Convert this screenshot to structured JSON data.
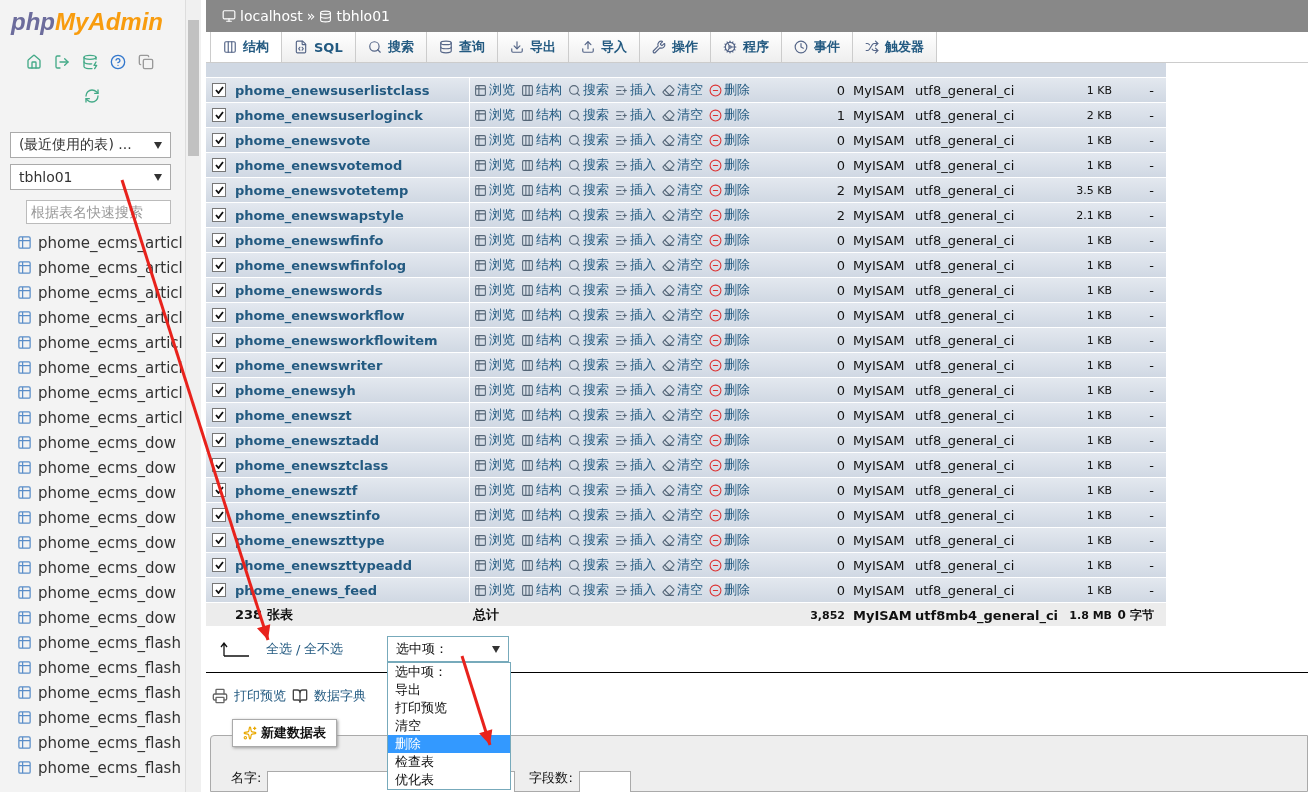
{
  "sidebar": {
    "logo_php": "php",
    "logo_name": "MyAdmin",
    "recent_select": "(最近使用的表) ...",
    "db_select": "tbhlo01",
    "filter_placeholder": "根据表名快速搜索",
    "tables": [
      "phome_ecms_articl",
      "phome_ecms_articl",
      "phome_ecms_articl",
      "phome_ecms_articl",
      "phome_ecms_articl",
      "phome_ecms_articl",
      "phome_ecms_articl",
      "phome_ecms_articl",
      "phome_ecms_dow",
      "phome_ecms_dow",
      "phome_ecms_dow",
      "phome_ecms_dow",
      "phome_ecms_dow",
      "phome_ecms_dow",
      "phome_ecms_dow",
      "phome_ecms_dow",
      "phome_ecms_flash",
      "phome_ecms_flash",
      "phome_ecms_flash",
      "phome_ecms_flash",
      "phome_ecms_flash",
      "phome_ecms_flash"
    ]
  },
  "breadcrumb": {
    "server": "localhost",
    "separator": "»",
    "database": "tbhlo01"
  },
  "tabs": [
    {
      "label": "结构",
      "selected": true
    },
    {
      "label": "SQL",
      "selected": false
    },
    {
      "label": "搜索",
      "selected": false
    },
    {
      "label": "查询",
      "selected": false
    },
    {
      "label": "导出",
      "selected": false
    },
    {
      "label": "导入",
      "selected": false
    },
    {
      "label": "操作",
      "selected": false
    },
    {
      "label": "程序",
      "selected": false
    },
    {
      "label": "事件",
      "selected": false
    },
    {
      "label": "触发器",
      "selected": false
    }
  ],
  "table": {
    "rows": [
      {
        "name": "phome_enewsuserlistclass",
        "checked": true,
        "actions": [
          "浏览",
          "结构",
          "搜索",
          "插入",
          "清空",
          "删除"
        ],
        "rows": "0",
        "engine": "MyISAM",
        "collation": "utf8_general_ci",
        "size": "1 KB",
        "overhead": "-"
      },
      {
        "name": "phome_enewsuserloginck",
        "checked": true,
        "actions": [
          "浏览",
          "结构",
          "搜索",
          "插入",
          "清空",
          "删除"
        ],
        "rows": "1",
        "engine": "MyISAM",
        "collation": "utf8_general_ci",
        "size": "2 KB",
        "overhead": "-"
      },
      {
        "name": "phome_enewsvote",
        "checked": true,
        "actions": [
          "浏览",
          "结构",
          "搜索",
          "插入",
          "清空",
          "删除"
        ],
        "rows": "0",
        "engine": "MyISAM",
        "collation": "utf8_general_ci",
        "size": "1 KB",
        "overhead": "-"
      },
      {
        "name": "phome_enewsvotemod",
        "checked": true,
        "actions": [
          "浏览",
          "结构",
          "搜索",
          "插入",
          "清空",
          "删除"
        ],
        "rows": "0",
        "engine": "MyISAM",
        "collation": "utf8_general_ci",
        "size": "1 KB",
        "overhead": "-"
      },
      {
        "name": "phome_enewsvotetemp",
        "checked": true,
        "actions": [
          "浏览",
          "结构",
          "搜索",
          "插入",
          "清空",
          "删除"
        ],
        "rows": "2",
        "engine": "MyISAM",
        "collation": "utf8_general_ci",
        "size": "3.5 KB",
        "overhead": "-"
      },
      {
        "name": "phome_enewswapstyle",
        "checked": true,
        "actions": [
          "浏览",
          "结构",
          "搜索",
          "插入",
          "清空",
          "删除"
        ],
        "rows": "2",
        "engine": "MyISAM",
        "collation": "utf8_general_ci",
        "size": "2.1 KB",
        "overhead": "-"
      },
      {
        "name": "phome_enewswfinfo",
        "checked": true,
        "actions": [
          "浏览",
          "结构",
          "搜索",
          "插入",
          "清空",
          "删除"
        ],
        "rows": "0",
        "engine": "MyISAM",
        "collation": "utf8_general_ci",
        "size": "1 KB",
        "overhead": "-"
      },
      {
        "name": "phome_enewswfinfolog",
        "checked": true,
        "actions": [
          "浏览",
          "结构",
          "搜索",
          "插入",
          "清空",
          "删除"
        ],
        "rows": "0",
        "engine": "MyISAM",
        "collation": "utf8_general_ci",
        "size": "1 KB",
        "overhead": "-"
      },
      {
        "name": "phome_enewswords",
        "checked": true,
        "actions": [
          "浏览",
          "结构",
          "搜索",
          "插入",
          "清空",
          "删除"
        ],
        "rows": "0",
        "engine": "MyISAM",
        "collation": "utf8_general_ci",
        "size": "1 KB",
        "overhead": "-"
      },
      {
        "name": "phome_enewsworkflow",
        "checked": true,
        "actions": [
          "浏览",
          "结构",
          "搜索",
          "插入",
          "清空",
          "删除"
        ],
        "rows": "0",
        "engine": "MyISAM",
        "collation": "utf8_general_ci",
        "size": "1 KB",
        "overhead": "-"
      },
      {
        "name": "phome_enewsworkflowitem",
        "checked": true,
        "actions": [
          "浏览",
          "结构",
          "搜索",
          "插入",
          "清空",
          "删除"
        ],
        "rows": "0",
        "engine": "MyISAM",
        "collation": "utf8_general_ci",
        "size": "1 KB",
        "overhead": "-"
      },
      {
        "name": "phome_enewswriter",
        "checked": true,
        "actions": [
          "浏览",
          "结构",
          "搜索",
          "插入",
          "清空",
          "删除"
        ],
        "rows": "0",
        "engine": "MyISAM",
        "collation": "utf8_general_ci",
        "size": "1 KB",
        "overhead": "-"
      },
      {
        "name": "phome_enewsyh",
        "checked": true,
        "actions": [
          "浏览",
          "结构",
          "搜索",
          "插入",
          "清空",
          "删除"
        ],
        "rows": "0",
        "engine": "MyISAM",
        "collation": "utf8_general_ci",
        "size": "1 KB",
        "overhead": "-"
      },
      {
        "name": "phome_enewszt",
        "checked": true,
        "actions": [
          "浏览",
          "结构",
          "搜索",
          "插入",
          "清空",
          "删除"
        ],
        "rows": "0",
        "engine": "MyISAM",
        "collation": "utf8_general_ci",
        "size": "1 KB",
        "overhead": "-"
      },
      {
        "name": "phome_enewsztadd",
        "checked": true,
        "actions": [
          "浏览",
          "结构",
          "搜索",
          "插入",
          "清空",
          "删除"
        ],
        "rows": "0",
        "engine": "MyISAM",
        "collation": "utf8_general_ci",
        "size": "1 KB",
        "overhead": "-"
      },
      {
        "name": "phome_enewsztclass",
        "checked": true,
        "actions": [
          "浏览",
          "结构",
          "搜索",
          "插入",
          "清空",
          "删除"
        ],
        "rows": "0",
        "engine": "MyISAM",
        "collation": "utf8_general_ci",
        "size": "1 KB",
        "overhead": "-"
      },
      {
        "name": "phome_enewsztf",
        "checked": true,
        "actions": [
          "浏览",
          "结构",
          "搜索",
          "插入",
          "清空",
          "删除"
        ],
        "rows": "0",
        "engine": "MyISAM",
        "collation": "utf8_general_ci",
        "size": "1 KB",
        "overhead": "-"
      },
      {
        "name": "phome_enewsztinfo",
        "checked": true,
        "actions": [
          "浏览",
          "结构",
          "搜索",
          "插入",
          "清空",
          "删除"
        ],
        "rows": "0",
        "engine": "MyISAM",
        "collation": "utf8_general_ci",
        "size": "1 KB",
        "overhead": "-"
      },
      {
        "name": "phome_enewszttype",
        "checked": true,
        "actions": [
          "浏览",
          "结构",
          "搜索",
          "插入",
          "清空",
          "删除"
        ],
        "rows": "0",
        "engine": "MyISAM",
        "collation": "utf8_general_ci",
        "size": "1 KB",
        "overhead": "-"
      },
      {
        "name": "phome_enewszttypeadd",
        "checked": true,
        "actions": [
          "浏览",
          "结构",
          "搜索",
          "插入",
          "清空",
          "删除"
        ],
        "rows": "0",
        "engine": "MyISAM",
        "collation": "utf8_general_ci",
        "size": "1 KB",
        "overhead": "-"
      },
      {
        "name": "phome_enews_feed",
        "checked": true,
        "actions": [
          "浏览",
          "结构",
          "搜索",
          "插入",
          "清空",
          "删除"
        ],
        "rows": "0",
        "engine": "MyISAM",
        "collation": "utf8_general_ci",
        "size": "1 KB",
        "overhead": "-"
      }
    ],
    "footer": {
      "count": "238 张表",
      "label": "总计",
      "rows": "3,852",
      "engine": "MyISAM",
      "collation": "utf8mb4_general_ci",
      "size": "1.8 MB",
      "overhead": "0 字节"
    }
  },
  "bulk": {
    "check_all": "全选",
    "separator": "/",
    "uncheck_all": "全不选",
    "select": "选中项：",
    "options": [
      {
        "label": "选中项：",
        "selected": false
      },
      {
        "label": "导出",
        "selected": false
      },
      {
        "label": "打印预览",
        "selected": false
      },
      {
        "label": "清空",
        "selected": false
      },
      {
        "label": "删除",
        "selected": true
      },
      {
        "label": "检查表",
        "selected": false
      },
      {
        "label": "优化表",
        "selected": false
      }
    ]
  },
  "links": [
    "打印预览",
    "数据字典"
  ],
  "create": {
    "button": "新建数据表",
    "name_label": "名字:",
    "fields_label": "字段数:"
  }
}
